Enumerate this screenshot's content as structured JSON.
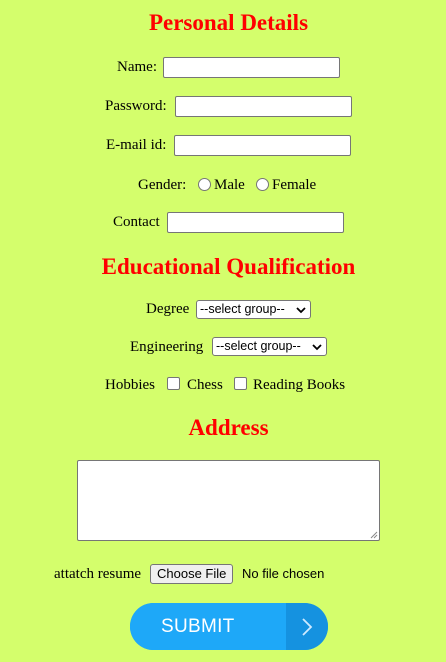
{
  "personal": {
    "heading": "Personal Details",
    "name_label": "Name:",
    "password_label": "Password:",
    "email_label": "E-mail id:",
    "gender_label": "Gender:",
    "gender_options": [
      "Male",
      "Female"
    ],
    "contact_label": "Contact"
  },
  "education": {
    "heading": "Educational Qualification",
    "degree_label": "Degree",
    "degree_selected": "--select group--",
    "engineering_label": "Engineering",
    "engineering_selected": "--select group--",
    "hobbies_label": "Hobbies",
    "hobbies_options": [
      "Chess",
      "Reading Books"
    ]
  },
  "address": {
    "heading": "Address"
  },
  "resume": {
    "label": "attatch resume",
    "button_label": "Choose File",
    "status": "No file chosen"
  },
  "submit": {
    "label": "SUBMIT",
    "icon": "chevron-right-icon"
  },
  "colors": {
    "background": "#d4fe6c",
    "heading": "#ff0000",
    "submit": "#1ea8f8"
  }
}
